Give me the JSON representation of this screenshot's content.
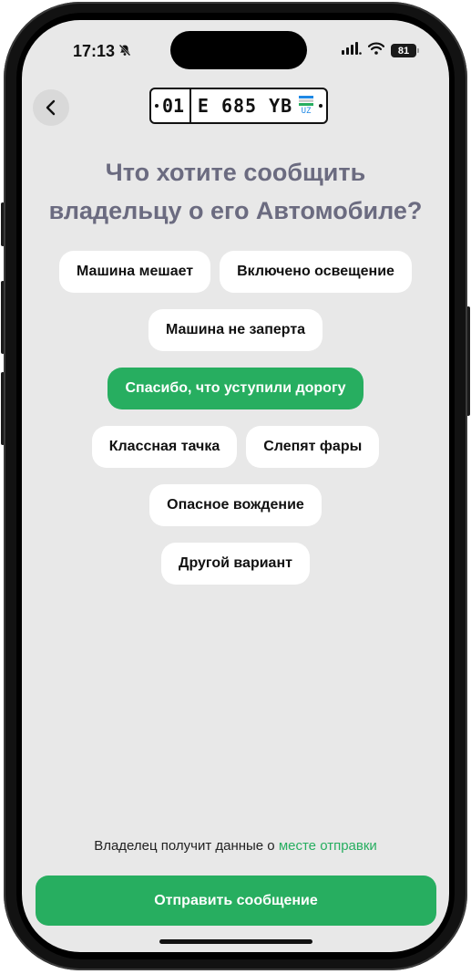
{
  "status": {
    "time": "17:13",
    "battery": "81"
  },
  "plate": {
    "region": "01",
    "number": "E 685 YB",
    "country_code": "UZ"
  },
  "title": {
    "line1": "Что хотите сообщить",
    "line2": "владельцу о его Автомобиле?"
  },
  "options": [
    {
      "label": "Машина мешает",
      "selected": false
    },
    {
      "label": "Включено освещение",
      "selected": false
    },
    {
      "label": "Машина не заперта",
      "selected": false
    },
    {
      "label": "Спасибо, что уступили дорогу",
      "selected": true
    },
    {
      "label": "Классная тачка",
      "selected": false
    },
    {
      "label": "Слепят фары",
      "selected": false
    },
    {
      "label": "Опасное вождение",
      "selected": false
    },
    {
      "label": "Другой вариант",
      "selected": false
    }
  ],
  "footer": {
    "note_prefix": "Владелец получит данные о",
    "note_link": "месте отправки",
    "send_label": "Отправить сообщение"
  },
  "colors": {
    "accent": "#27ae60",
    "title": "#6b6b80",
    "background": "#e8e8e8"
  }
}
